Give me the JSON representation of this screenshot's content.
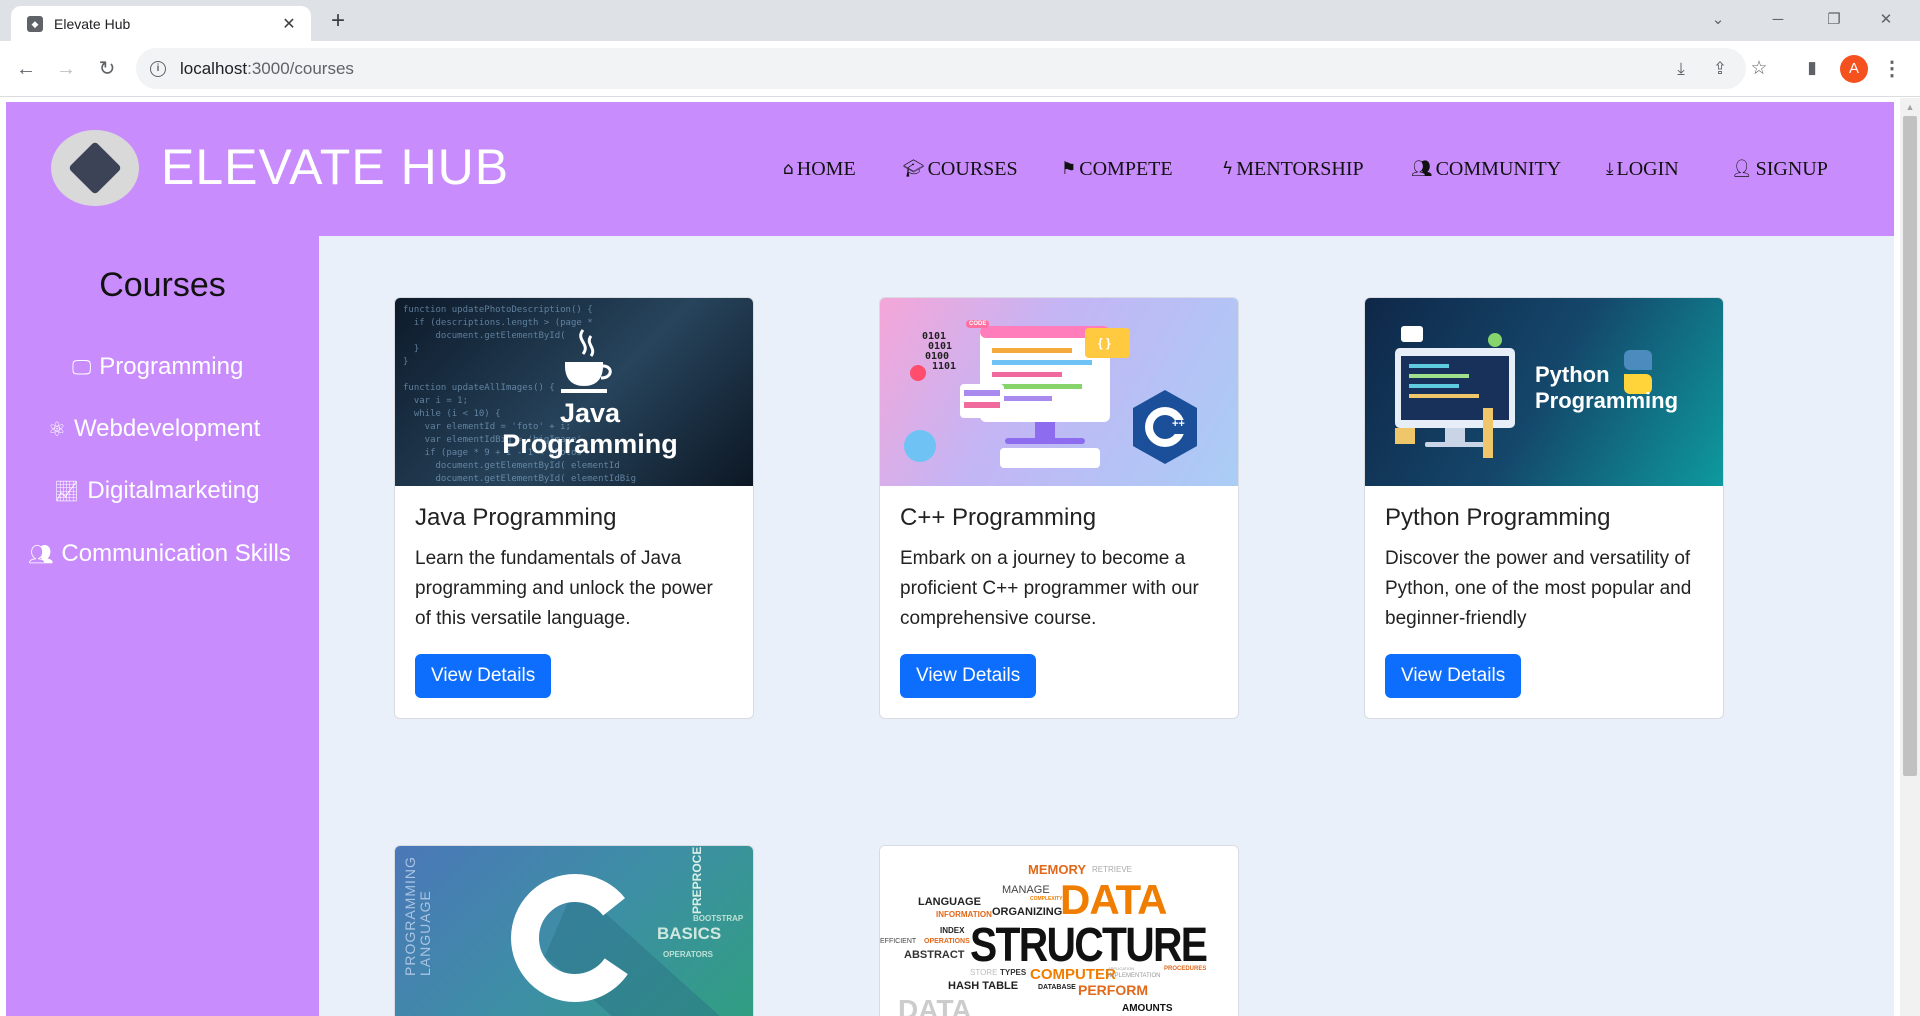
{
  "browser": {
    "tab_title": "Elevate Hub",
    "url_host": "localhost",
    "url_rest": ":3000/courses",
    "profile_initial": "A"
  },
  "header": {
    "brand": "ELEVATE HUB",
    "nav": [
      {
        "label": "HOME",
        "icon": "home-icon"
      },
      {
        "label": "COURSES",
        "icon": "graduation-cap-icon"
      },
      {
        "label": "COMPETE",
        "icon": "flag-icon"
      },
      {
        "label": "MENTORSHIP",
        "icon": "bolt-icon"
      },
      {
        "label": "COMMUNITY",
        "icon": "users-icon"
      },
      {
        "label": "LOGIN",
        "icon": "download-icon"
      },
      {
        "label": "SIGNUP",
        "icon": "user-plus-icon"
      }
    ]
  },
  "sidebar": {
    "title": "Courses",
    "items": [
      {
        "label": "Programming",
        "icon": "monitor-code-icon"
      },
      {
        "label": "Webdevelopment",
        "icon": "atom-icon"
      },
      {
        "label": "Digitalmarketing",
        "icon": "trend-chart-icon"
      },
      {
        "label": "Communication Skills",
        "icon": "people-icon"
      }
    ]
  },
  "cards": [
    {
      "title": "Java Programming",
      "text": "Learn the fundamentals of Java programming and unlock the power of this versatile language.",
      "button": "View Details",
      "image_text": [
        "Java",
        "Programming"
      ]
    },
    {
      "title": "C++ Programming",
      "text": "Embark on a journey to become a proficient C++ programmer with our comprehensive course.",
      "button": "View Details",
      "image_text": [
        "CODE",
        "0101",
        "0101",
        "0100",
        "1101",
        "{ }"
      ]
    },
    {
      "title": "Python Programming",
      "text": "Discover the power and versatility of Python, one of the most popular and beginner-friendly",
      "button": "View Details",
      "image_text": [
        "Python",
        "Programming"
      ]
    }
  ],
  "partial_cards": [
    {
      "image_text": [
        "PROGRAMMING",
        "LANGUAGE",
        "BASICS",
        "PREPROCE",
        "BOOTSTRAP",
        "OPERATORS"
      ]
    },
    {
      "image_text": [
        "MEMORY",
        "RETRIEVE",
        "DATA",
        "MANAGE",
        "COMPLEXITY",
        "LANGUAGE",
        "ORGANIZING",
        "INFORMATION",
        "STRUCTURE",
        "INDEX",
        "EFFICIENT",
        "OPERATIONS",
        "ABSTRACT",
        "STORE",
        "TYPES",
        "COMPUTER",
        "APPLICATION",
        "IMPLEMENTATION",
        "PROCEDURES",
        "HASH TABLE",
        "DATABASE",
        "PERFORM",
        "DATA",
        "AMOUNTS"
      ]
    }
  ]
}
